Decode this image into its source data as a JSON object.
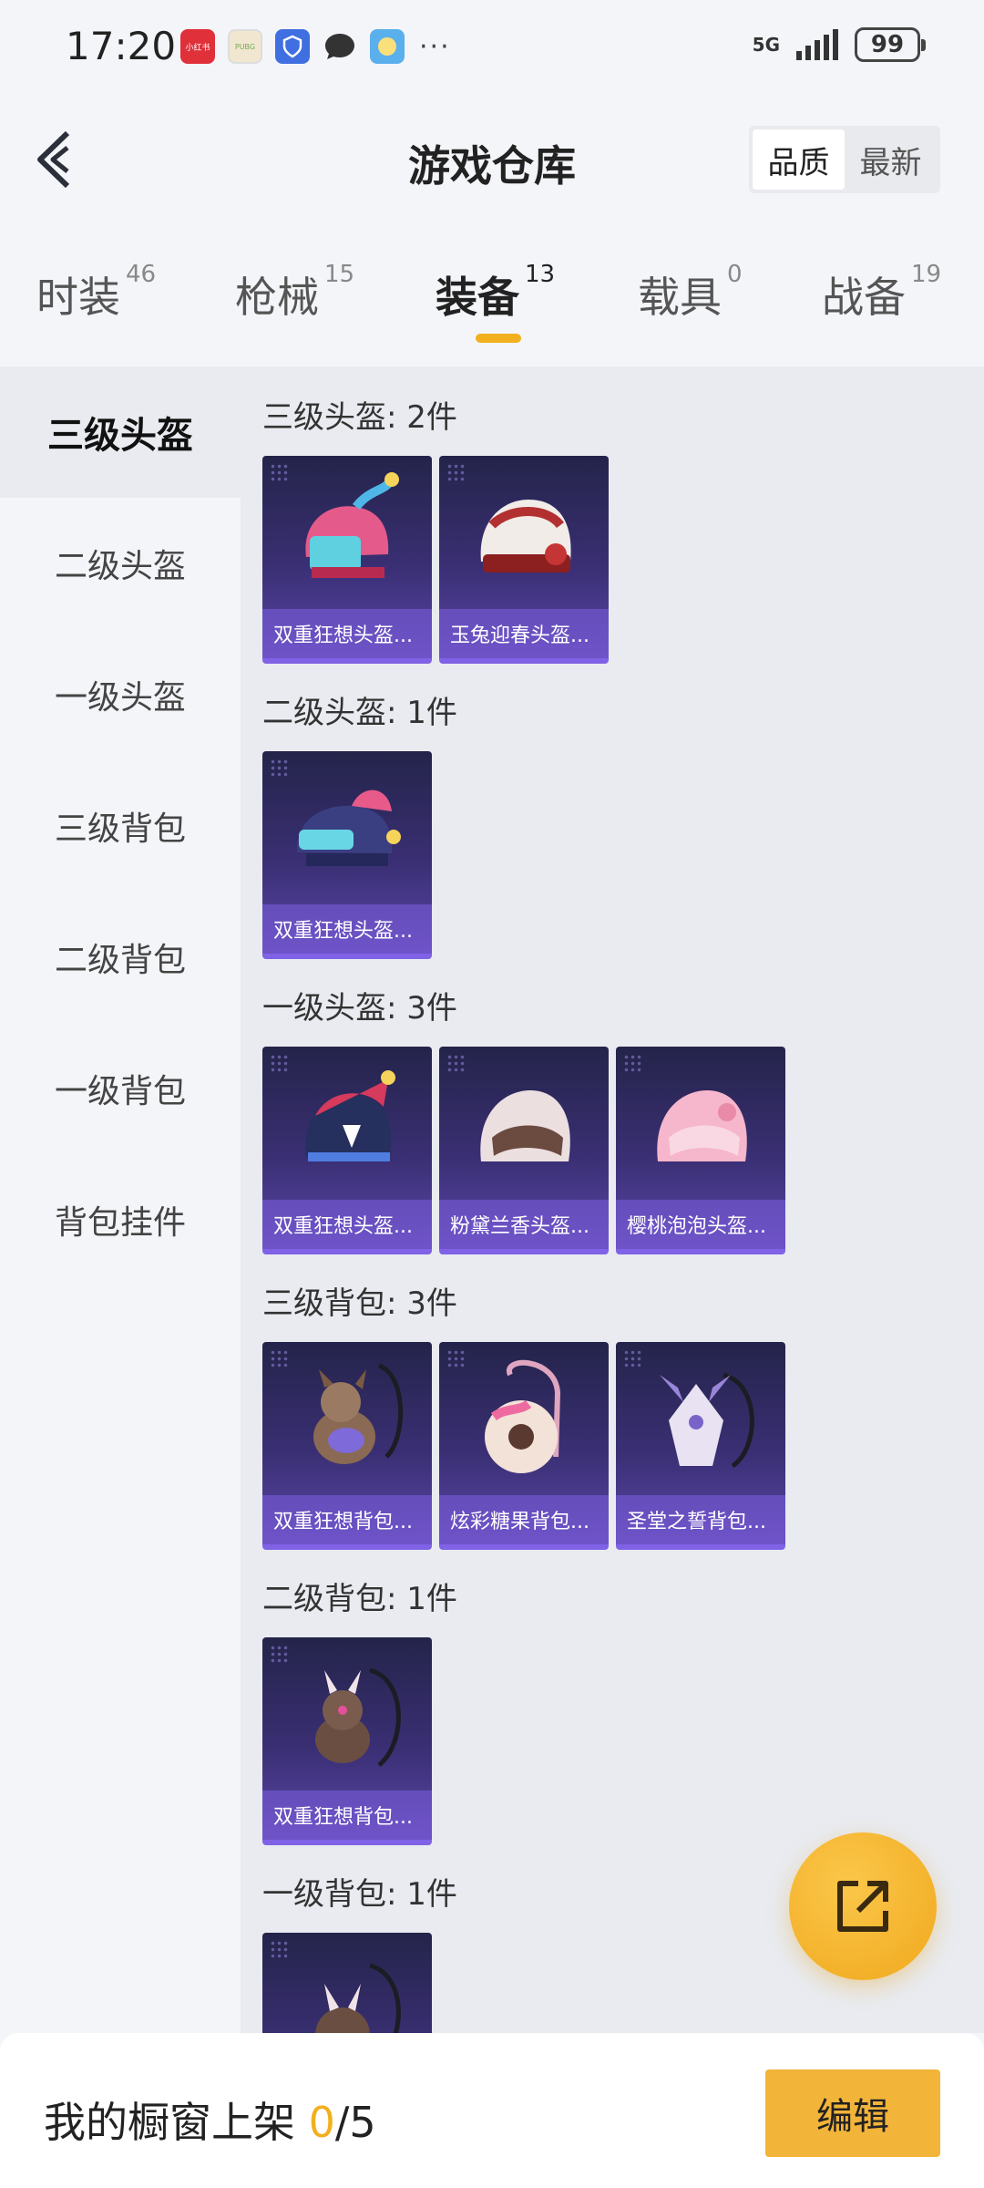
{
  "status_bar": {
    "time": "17:20",
    "apps": [
      {
        "icon": "xiaohongshu-app-icon",
        "text": "小红书"
      },
      {
        "icon": "game-app-icon",
        "text": "PUBG"
      },
      {
        "icon": "shield-app-icon",
        "text": ""
      },
      {
        "icon": "chat-bubble-icon",
        "text": ""
      },
      {
        "icon": "weather-app-icon",
        "text": ""
      }
    ],
    "more": "···",
    "network": "5G",
    "battery": "99"
  },
  "header": {
    "title": "游戏仓库",
    "sort_options": [
      "品质",
      "最新"
    ],
    "active_sort": "品质"
  },
  "tabs": [
    {
      "label": "时装",
      "count": "46"
    },
    {
      "label": "枪械",
      "count": "15"
    },
    {
      "label": "装备",
      "count": "13"
    },
    {
      "label": "载具",
      "count": "0"
    },
    {
      "label": "战备",
      "count": "19"
    }
  ],
  "sidebar": [
    "三级头盔",
    "二级头盔",
    "一级头盔",
    "三级背包",
    "二级背包",
    "一级背包",
    "背包挂件"
  ],
  "sections": [
    {
      "title": "三级头盔: 2件",
      "items": [
        "双重狂想头盔...",
        "玉兔迎春头盔..."
      ]
    },
    {
      "title": "二级头盔: 1件",
      "items": [
        "双重狂想头盔..."
      ]
    },
    {
      "title": "一级头盔: 3件",
      "items": [
        "双重狂想头盔...",
        "粉黛兰香头盔...",
        "樱桃泡泡头盔..."
      ]
    },
    {
      "title": "三级背包: 3件",
      "items": [
        "双重狂想背包...",
        "炫彩糖果背包...",
        "圣堂之誓背包..."
      ]
    },
    {
      "title": "二级背包: 1件",
      "items": [
        "双重狂想背包..."
      ]
    },
    {
      "title": "一级背包: 1件",
      "items": [
        ""
      ]
    }
  ],
  "bottom": {
    "label": "我的橱窗上架",
    "current": "0",
    "total": "/5",
    "edit": "编辑"
  },
  "colors": {
    "accent": "#f2b01e",
    "card_bg": "#3a2f74",
    "card_border": "#7f62e6"
  }
}
